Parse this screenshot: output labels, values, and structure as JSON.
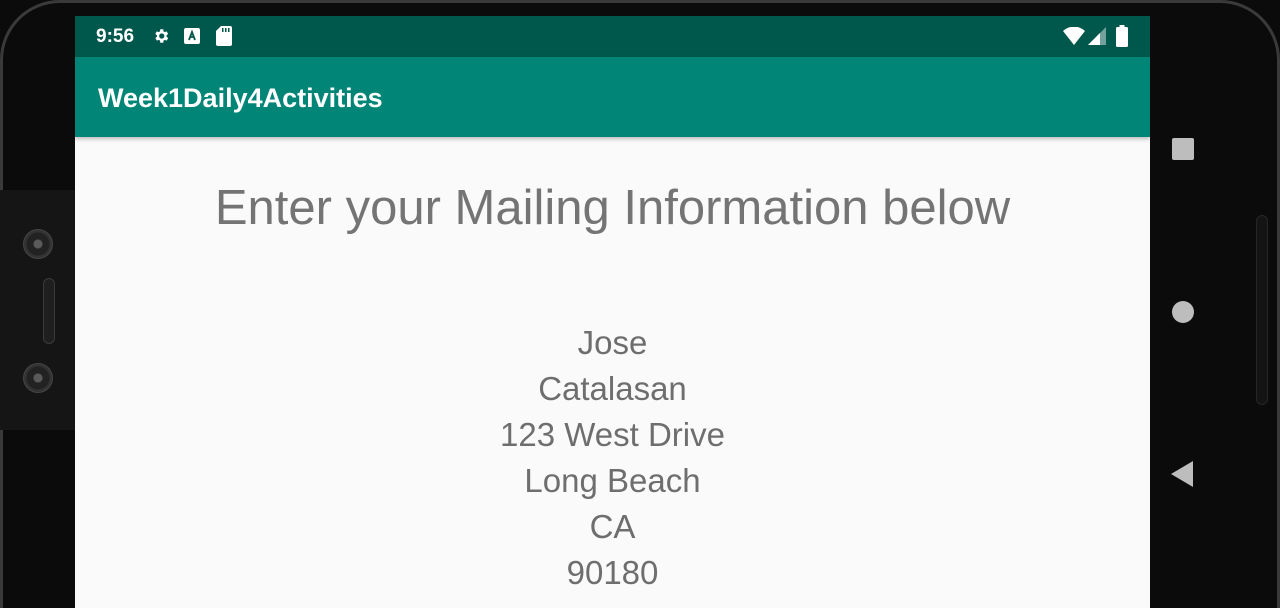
{
  "status_bar": {
    "time": "9:56",
    "left_icons": [
      "gear-icon",
      "a-letter-icon",
      "sd-card-icon"
    ],
    "right_icons": [
      "wifi-icon",
      "signal-icon",
      "battery-icon"
    ]
  },
  "app_bar": {
    "title": "Week1Daily4Activities"
  },
  "content": {
    "heading": "Enter your Mailing Information below",
    "address": {
      "first_name": "Jose",
      "last_name": "Catalasan",
      "street": "123 West Drive",
      "city": "Long Beach",
      "state": "CA",
      "zip": "90180"
    }
  },
  "nav_bar": {
    "buttons": [
      "recents-button",
      "home-button",
      "back-button"
    ]
  },
  "colors": {
    "status_bar": "#00574b",
    "app_bar": "#008577",
    "background": "#fafafa",
    "text_gray": "#747474"
  }
}
